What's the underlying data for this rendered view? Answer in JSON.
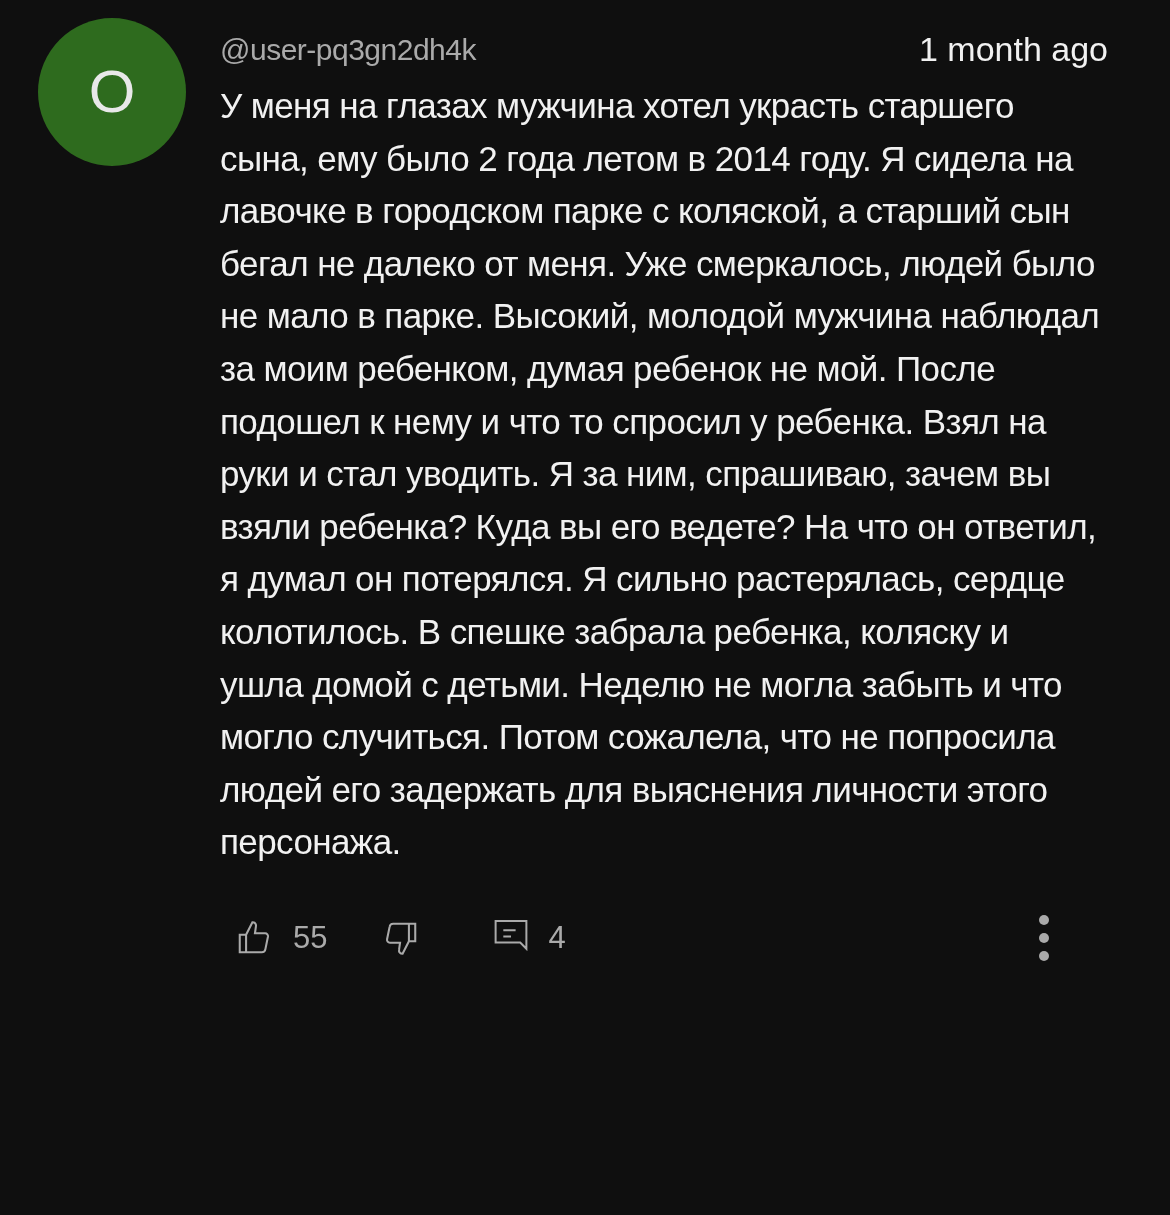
{
  "avatar": {
    "initial": "O",
    "color": "#2e6b1e"
  },
  "author": "@user-pq3gn2dh4k",
  "time": "1 month ago",
  "text": "У меня на глазах мужчина хотел украсть старшего сына, ему было 2 года летом в 2014 году. Я сидела на лавочке в городском парке с коляской, а старший сын бегал не далеко от меня. Уже смеркалось, людей было не мало в парке. Высокий, молодой мужчина наблюдал за моим ребенком, думая ребенок не мой. После подошел к нему и что то спросил у ребенка. Взял на руки и стал уводить. Я за ним, спрашиваю, зачем вы взяли ребенка? Куда вы его ведете? На что он ответил, я думал он потерялся. Я сильно растерялась, сердце колотилось. В спешке забрала ребенка, коляску и ушла домой с детьми. Неделю не могла забыть и что могло случиться. Потом сожалела, что не попросила людей его задержать для выяснения личности этого персонажа.",
  "likes": "55",
  "replies": "4"
}
